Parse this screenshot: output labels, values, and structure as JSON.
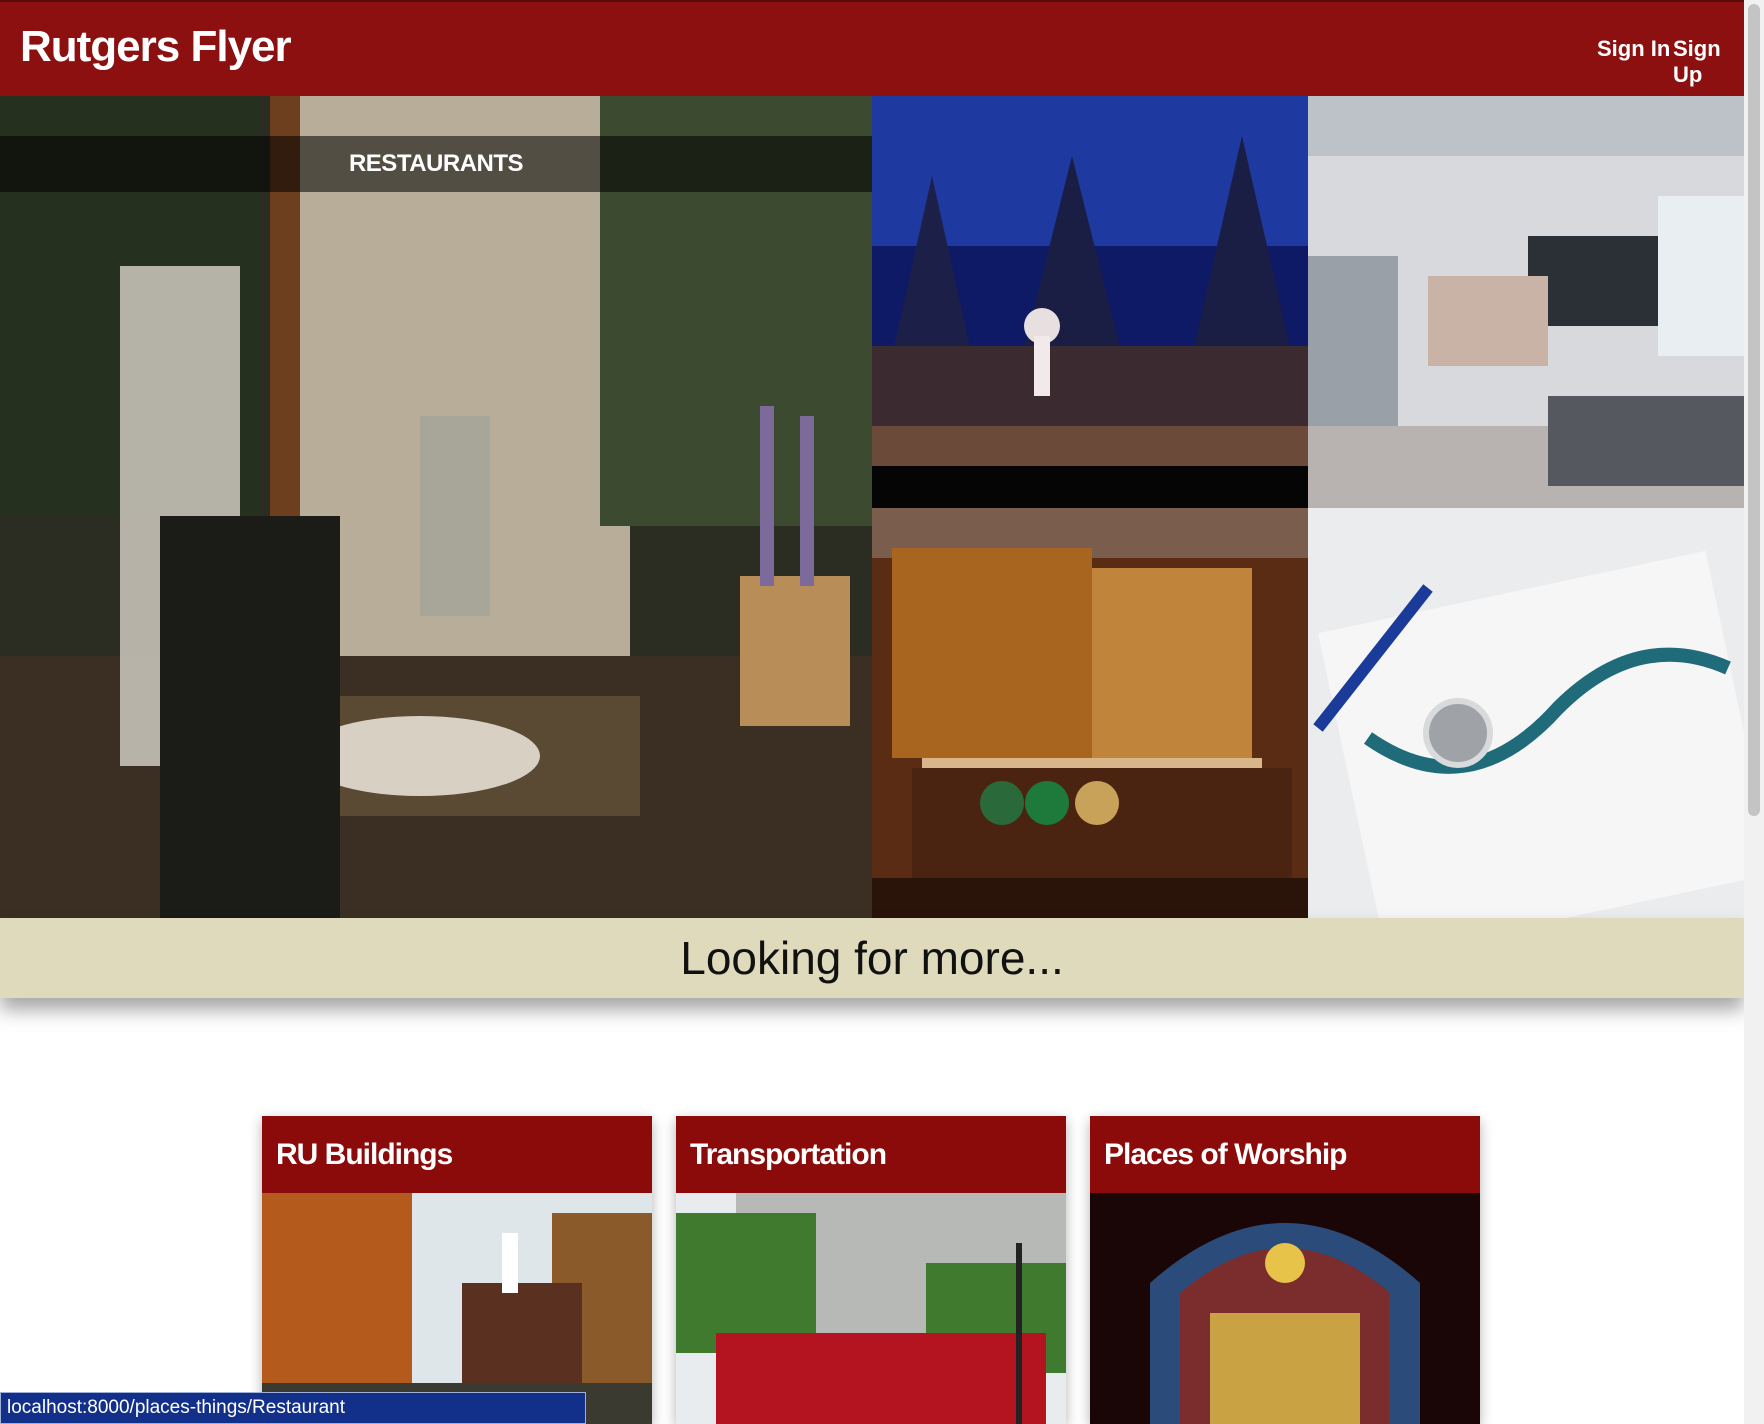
{
  "header": {
    "brand": "Rutgers Flyer",
    "sign_in": "Sign In",
    "sign_up": "Sign Up"
  },
  "hero": {
    "tiles": [
      {
        "caption": "RESTAURANTS",
        "image": "restaurant-interior"
      },
      {
        "image": "ballet-stage"
      },
      {
        "image": "shopping-mall"
      },
      {
        "image": "pub-bar"
      },
      {
        "image": "stethoscope"
      }
    ]
  },
  "banner": {
    "text": "Looking for more..."
  },
  "cards": [
    {
      "title": "RU Buildings",
      "image": "campus-building"
    },
    {
      "title": "Transportation",
      "image": "rutgers-bus"
    },
    {
      "title": "Places of Worship",
      "image": "stained-glass"
    }
  ],
  "status_bar": {
    "url": "localhost:8000/places-things/Restaurant"
  },
  "colors": {
    "brand_red": "#8c1010",
    "banner_beige": "#e0dabd",
    "status_blue": "#12308a"
  }
}
